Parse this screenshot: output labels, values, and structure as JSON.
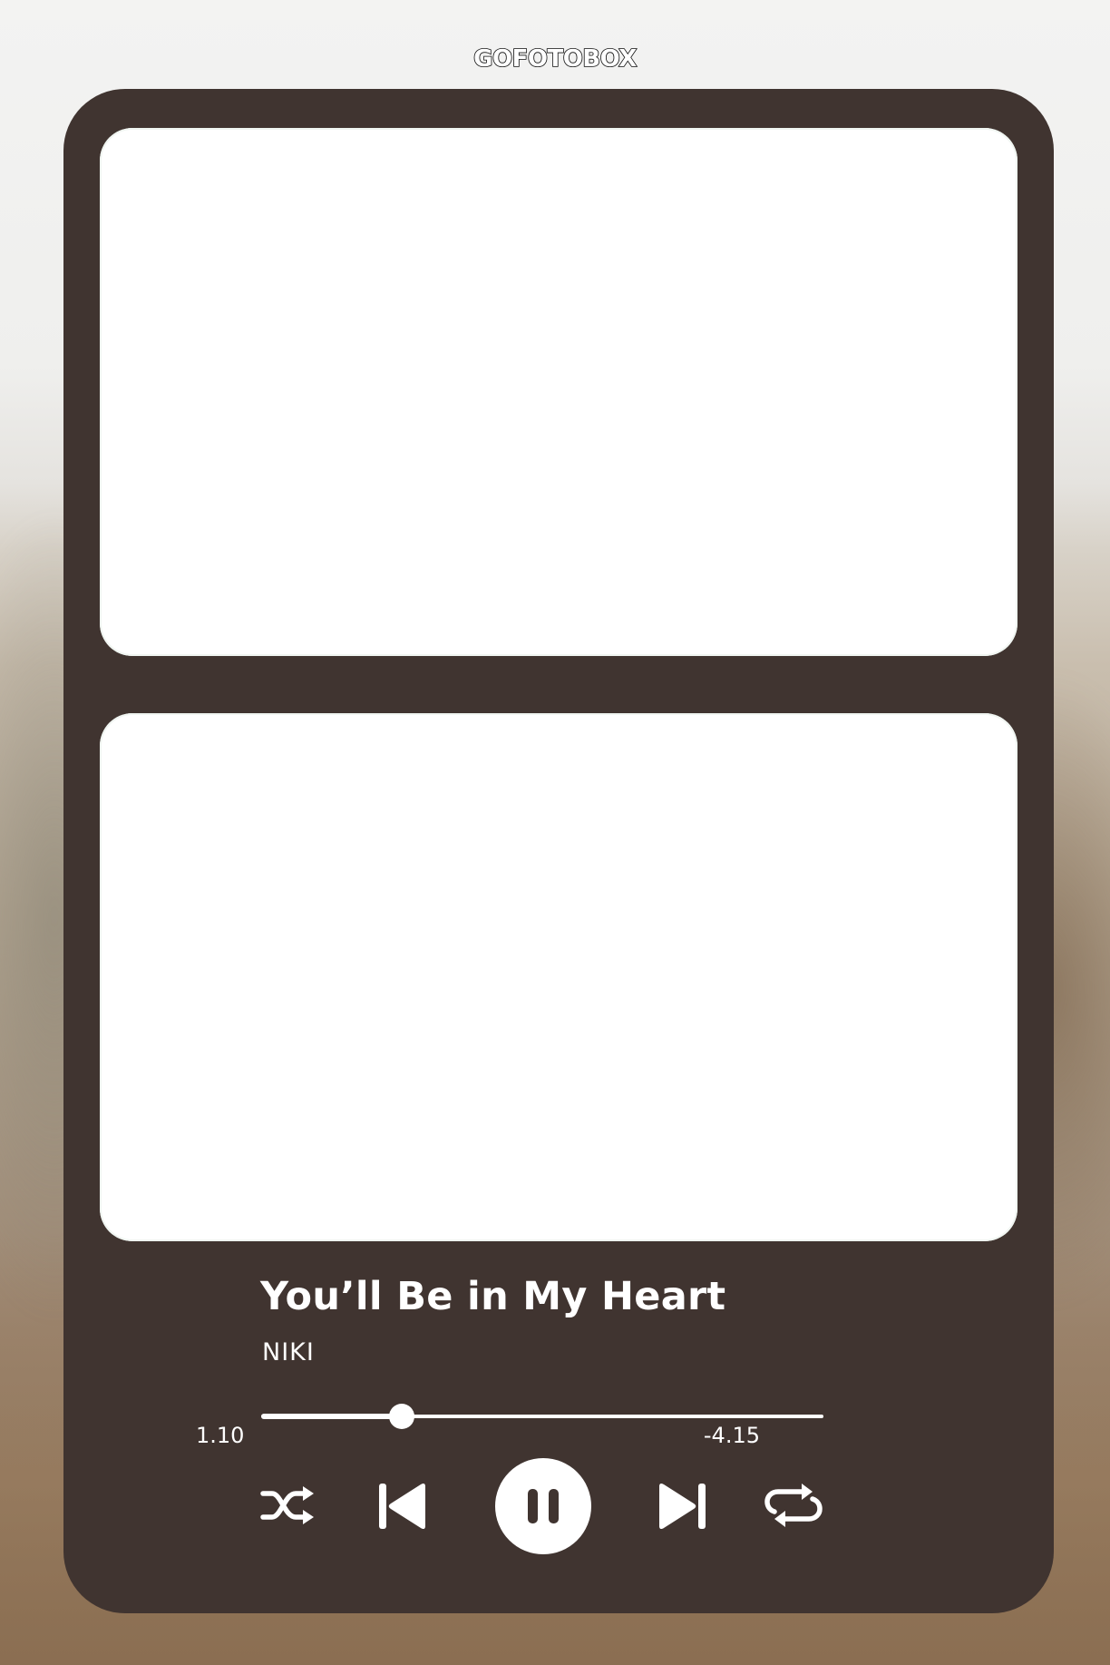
{
  "brand": "GOFOTOBOX",
  "player": {
    "title": "You’ll Be in My Heart",
    "artist": "NIKI",
    "elapsed": "1.10",
    "remaining": "-4.15",
    "progress_fraction": 0.25
  },
  "icons": {
    "shuffle": "shuffle-icon",
    "previous": "skip-previous-icon",
    "pause": "pause-icon",
    "next": "skip-next-icon",
    "repeat": "repeat-icon"
  },
  "colors": {
    "card": "#403430",
    "photo": "#ffffff",
    "text": "#ffffff"
  }
}
